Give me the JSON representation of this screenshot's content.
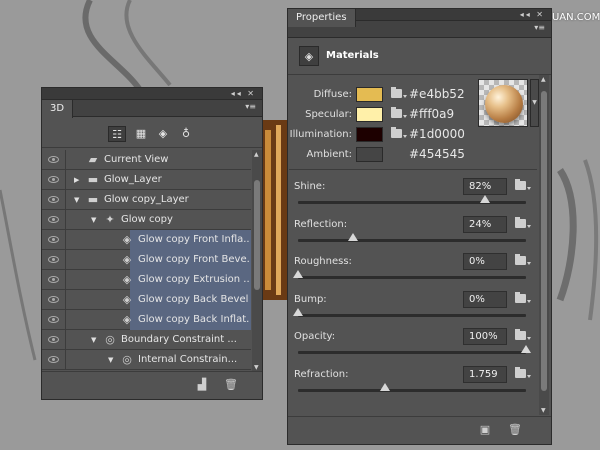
{
  "watermark": "思缘设计论坛 WWW.MISSVUAN.COM",
  "panel3d": {
    "tab": "3D",
    "layers": [
      {
        "label": "Current View",
        "indent": 0,
        "expander": "none",
        "icon": "camera-icon",
        "glyph": "▰",
        "selected": false
      },
      {
        "label": "Glow_Layer",
        "indent": 0,
        "expander": "collapsed",
        "icon": "folder-icon",
        "glyph": "▬",
        "selected": false
      },
      {
        "label": "Glow copy_Layer",
        "indent": 0,
        "expander": "expanded",
        "icon": "folder-icon",
        "glyph": "▬",
        "selected": false
      },
      {
        "label": "Glow copy",
        "indent": 1,
        "expander": "expanded",
        "icon": "mesh-icon",
        "glyph": "✦",
        "selected": false
      },
      {
        "label": "Glow copy Front Infla...",
        "indent": 2,
        "expander": "none",
        "icon": "material-icon",
        "glyph": "◈",
        "selected": true
      },
      {
        "label": "Glow copy Front Beve...",
        "indent": 2,
        "expander": "none",
        "icon": "material-icon",
        "glyph": "◈",
        "selected": true
      },
      {
        "label": "Glow copy Extrusion ...",
        "indent": 2,
        "expander": "none",
        "icon": "material-icon",
        "glyph": "◈",
        "selected": true
      },
      {
        "label": "Glow copy Back Bevel...",
        "indent": 2,
        "expander": "none",
        "icon": "material-icon",
        "glyph": "◈",
        "selected": true
      },
      {
        "label": "Glow copy Back Inflat...",
        "indent": 2,
        "expander": "none",
        "icon": "material-icon",
        "glyph": "◈",
        "selected": true
      },
      {
        "label": "Boundary Constraint ...",
        "indent": 1,
        "expander": "expanded",
        "icon": "constraint-icon",
        "glyph": "◎",
        "selected": false
      },
      {
        "label": "Internal Constrain...",
        "indent": 2,
        "expander": "expanded",
        "icon": "constraint-icon",
        "glyph": "◎",
        "selected": false
      }
    ]
  },
  "properties": {
    "tab": "Properties",
    "section": "Materials",
    "colors": [
      {
        "label": "Diffuse:",
        "hex": "#e4bb52",
        "swatch": "#e4bb52",
        "has_folder": true
      },
      {
        "label": "Specular:",
        "hex": "#fff0a9",
        "swatch": "#fff0a9",
        "has_folder": true
      },
      {
        "label": "Illumination:",
        "hex": "#1d0000",
        "swatch": "#1d0000",
        "has_folder": true
      },
      {
        "label": "Ambient:",
        "hex": "#454545",
        "swatch": "#454545",
        "has_folder": false
      }
    ],
    "sliders": [
      {
        "label": "Shine:",
        "value": "82%",
        "fraction": 0.82
      },
      {
        "label": "Reflection:",
        "value": "24%",
        "fraction": 0.24
      },
      {
        "label": "Roughness:",
        "value": "0%",
        "fraction": 0.0
      },
      {
        "label": "Bump:",
        "value": "0%",
        "fraction": 0.0
      },
      {
        "label": "Opacity:",
        "value": "100%",
        "fraction": 1.0
      },
      {
        "label": "Refraction:",
        "value": "1.759",
        "fraction": 0.38
      }
    ]
  }
}
